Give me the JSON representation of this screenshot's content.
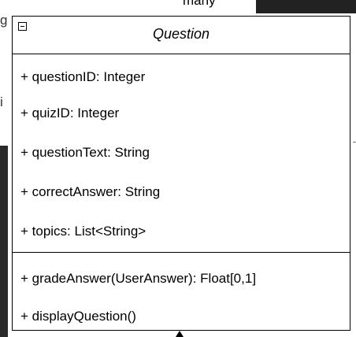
{
  "background": {
    "top_label": "many",
    "left_letters": [
      "g",
      "i"
    ]
  },
  "class": {
    "name": "Question",
    "collapse_icon": "minus-box-icon",
    "attributes": [
      "+ questionID: Integer",
      "+ quizID: Integer",
      "+ questionText: String",
      "+ correctAnswer: String",
      "+ topics: List<String>"
    ],
    "operations": [
      "+ gradeAnswer(UserAnswer): Float[0,1]",
      "+ displayQuestion()"
    ]
  }
}
